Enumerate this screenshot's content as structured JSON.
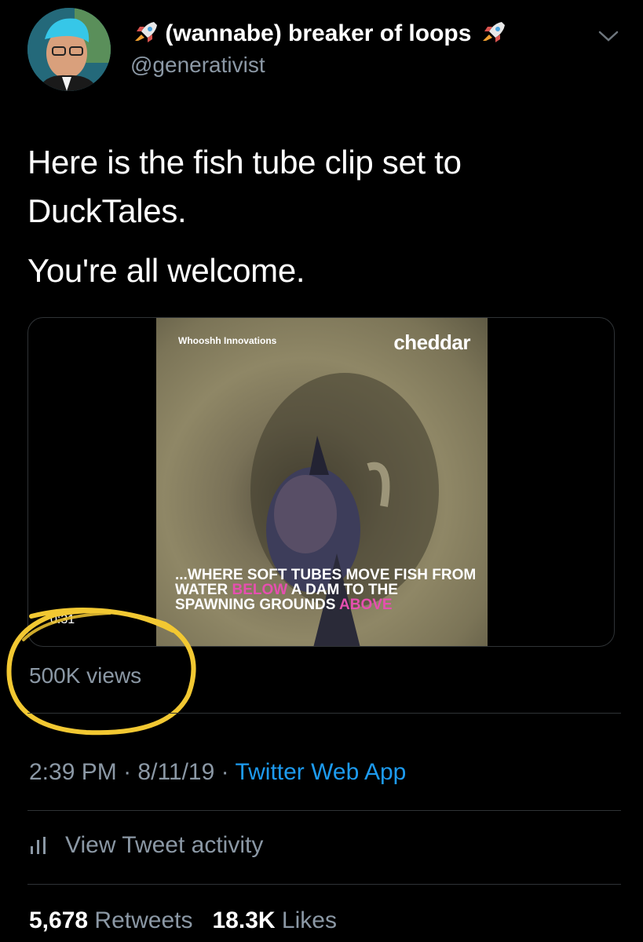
{
  "user": {
    "display_name": "(wannabe) breaker of loops",
    "handle": "@generativist",
    "avatar_icon": "profile-photo",
    "name_emoji_icon": "rocket-icon"
  },
  "tweet": {
    "text_line1": "Here is the fish tube clip set to DuckTales.",
    "text_line2": "You're all welcome."
  },
  "media": {
    "video_source_tag": "Whooshh Innovations",
    "video_brand": "cheddar",
    "caption_part1": "...WHERE SOFT TUBES MOVE FISH FROM WATER ",
    "caption_highlight1": "BELOW",
    "caption_part2": " A DAM TO THE SPAWNING GROUNDS ",
    "caption_highlight2": "ABOVE",
    "duration": "0:31",
    "views": "500K views"
  },
  "meta": {
    "time": "2:39 PM",
    "sep1": "·",
    "date": "8/11/19",
    "sep2": "·",
    "app": "Twitter Web App"
  },
  "activity": {
    "label": "View Tweet activity"
  },
  "stats": {
    "retweets_count": "5,678",
    "retweets_label": "Retweets",
    "likes_count": "18.3K",
    "likes_label": "Likes"
  },
  "colors": {
    "background": "#000000",
    "secondary_text": "#8b98a5",
    "link": "#1d9bf0",
    "highlight_circle": "#f2c832",
    "caption_pink": "#e64fb0"
  }
}
